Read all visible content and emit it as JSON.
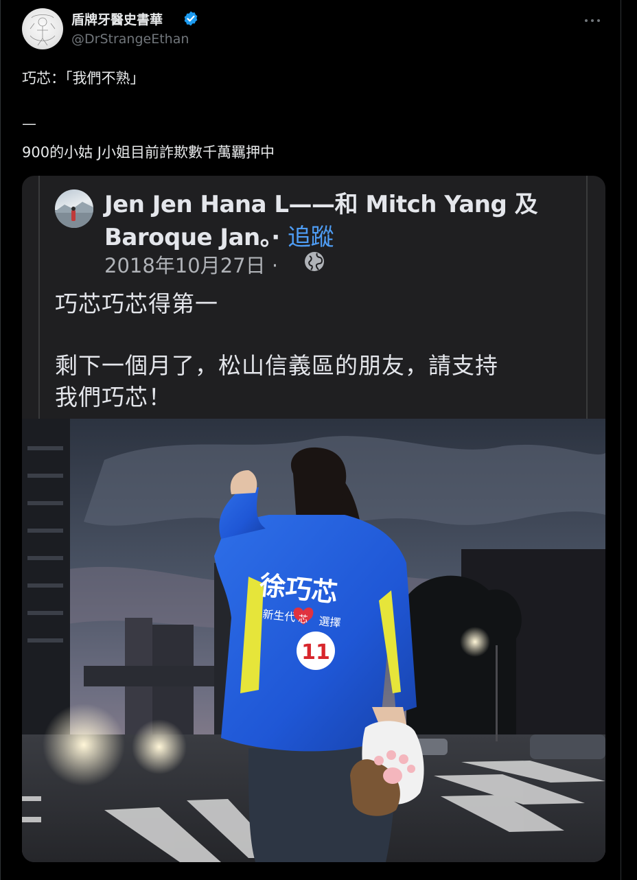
{
  "header": {
    "display_name": "盾牌牙醫史書華",
    "handle": "@DrStrangeEthan",
    "verified_icon": "verified-badge-icon",
    "more_icon": "more-options-icon"
  },
  "tweet": {
    "line1": "巧芯：「我們不熟」",
    "divider": "—",
    "line2": "900的小姑 J小姐目前詐欺數千萬羈押中"
  },
  "embedded_post": {
    "author_line1_a": "Jen Jen Hana L——和 Mitch Yang 及",
    "author_line2_a": "Baroque Jan。·",
    "follow_label": "追蹤",
    "date": "2018年10月27日 ·",
    "privacy_icon": "globe-icon",
    "text_line1": "巧芯巧芯得第一",
    "text_line2": "剩下一個月了，松山信義區的朋友，請支持",
    "text_line3": "我們巧芯！"
  },
  "photo": {
    "jacket_name": "徐巧芯",
    "jacket_slogan_a": "新生代",
    "jacket_slogan_heart": "芯",
    "jacket_slogan_b": "選擇",
    "jacket_number": "11"
  },
  "colors": {
    "background": "#000000",
    "text": "#e7e9ea",
    "muted": "#71767b",
    "verified": "#1d9bf0",
    "follow_link": "#4e9df5",
    "card": "#1f1f21",
    "jacket_blue": "#1f57d6",
    "jacket_yellow": "#e6e53a"
  }
}
